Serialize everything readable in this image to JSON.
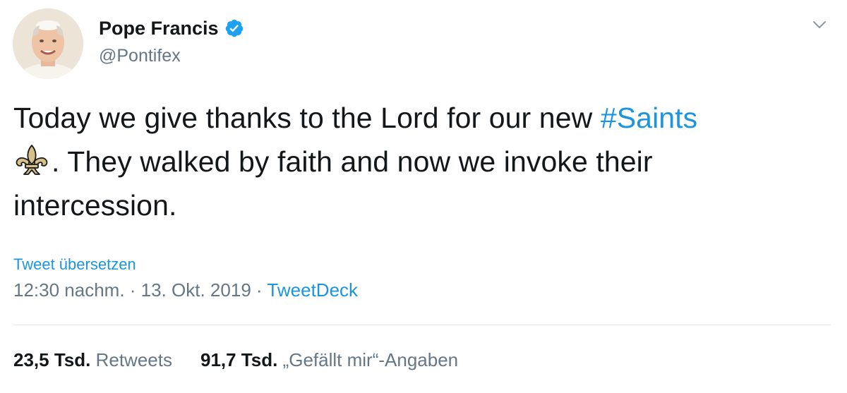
{
  "author": {
    "name": "Pope Francis",
    "handle": "@Pontifex",
    "verified": true,
    "verified_icon": "verified-badge-icon",
    "avatar_icon": "avatar"
  },
  "tweet": {
    "text_part1": "Today we give thanks to the Lord for our new ",
    "hashtag": "#Saints",
    "emoji_icon": "fleur-de-lis-icon",
    "text_part2": ". They walked by faith and now we invoke their intercession."
  },
  "translate_label": "Tweet übersetzen",
  "meta": {
    "time": "12:30 nachm.",
    "sep1": " · ",
    "date": "13. Okt. 2019",
    "sep2": " · ",
    "source": "TweetDeck"
  },
  "stats": {
    "retweets_count": "23,5 Tsd.",
    "retweets_label": "Retweets",
    "likes_count": "91,7 Tsd.",
    "likes_label": "„Gefällt mir“-Angaben"
  },
  "colors": {
    "link": "#1b95e0",
    "secondary": "#657786",
    "text": "#14171a",
    "divider": "#e1e8ed"
  }
}
